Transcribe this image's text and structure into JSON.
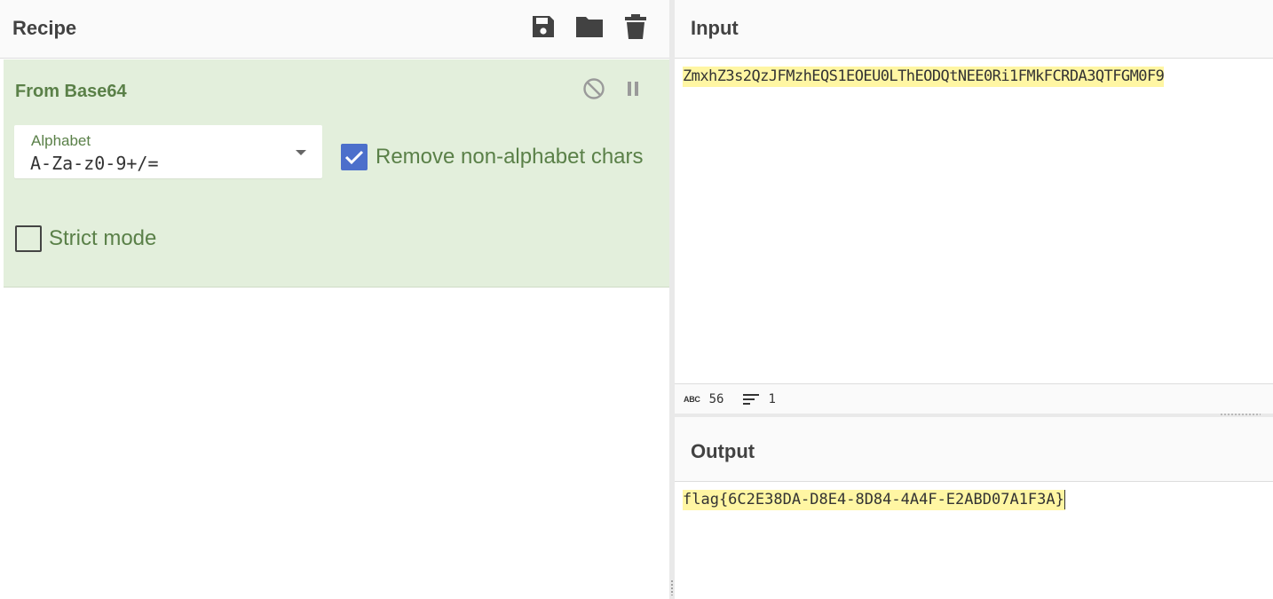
{
  "recipe": {
    "title": "Recipe",
    "icons": [
      "save-icon",
      "folder-icon",
      "trash-icon"
    ],
    "operation": {
      "title": "From Base64",
      "alphabet_label": "Alphabet",
      "alphabet_value": "A-Za-z0-9+/=",
      "remove_non_alphabet": {
        "label": "Remove non-alphabet chars",
        "checked": true
      },
      "strict_mode": {
        "label": "Strict mode",
        "checked": false
      }
    }
  },
  "input": {
    "title": "Input",
    "text": "ZmxhZ3s2QzJFMzhEQS1EOEU0LThEODQtNEE0Ri1FMkFCRDA3QTFGM0F9",
    "stats": {
      "chars": "56",
      "lines": "1"
    }
  },
  "output": {
    "title": "Output",
    "text": "flag{6C2E38DA-D8E4-8D84-4A4F-E2ABD07A1F3A}"
  },
  "colors": {
    "operation_bg": "#e3efdc",
    "operation_text": "#5a8048",
    "checkbox": "#4c6fcb",
    "highlight": "#fff6a3"
  }
}
